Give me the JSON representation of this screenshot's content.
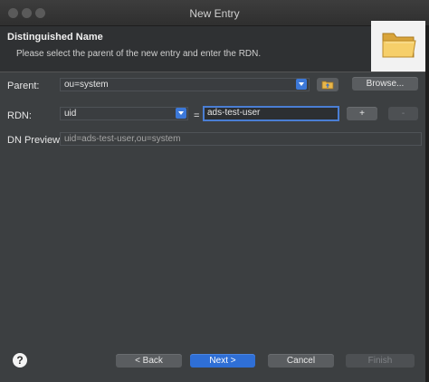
{
  "window": {
    "title": "New Entry"
  },
  "header": {
    "title": "Distinguished Name",
    "description": "Please select the parent of the new entry and enter the RDN.",
    "image_icon": "folder-icon"
  },
  "form": {
    "parent": {
      "label": "Parent:",
      "value": "ou=system",
      "browse_label": "Browse...",
      "parent_icon": "folder-up-icon"
    },
    "rdn": {
      "label": "RDN:",
      "attribute": "uid",
      "equals": "=",
      "value": "ads-test-user",
      "add_label": "+",
      "remove_label": "-"
    },
    "dn_preview": {
      "label": "DN Preview:",
      "value": "uid=ads-test-user,ou=system"
    }
  },
  "footer": {
    "help_label": "?",
    "back_label": "< Back",
    "next_label": "Next >",
    "cancel_label": "Cancel",
    "finish_label": "Finish"
  },
  "colors": {
    "accent": "#2f6fd6",
    "background": "#3c3f41",
    "focus": "#4a7ed4"
  }
}
